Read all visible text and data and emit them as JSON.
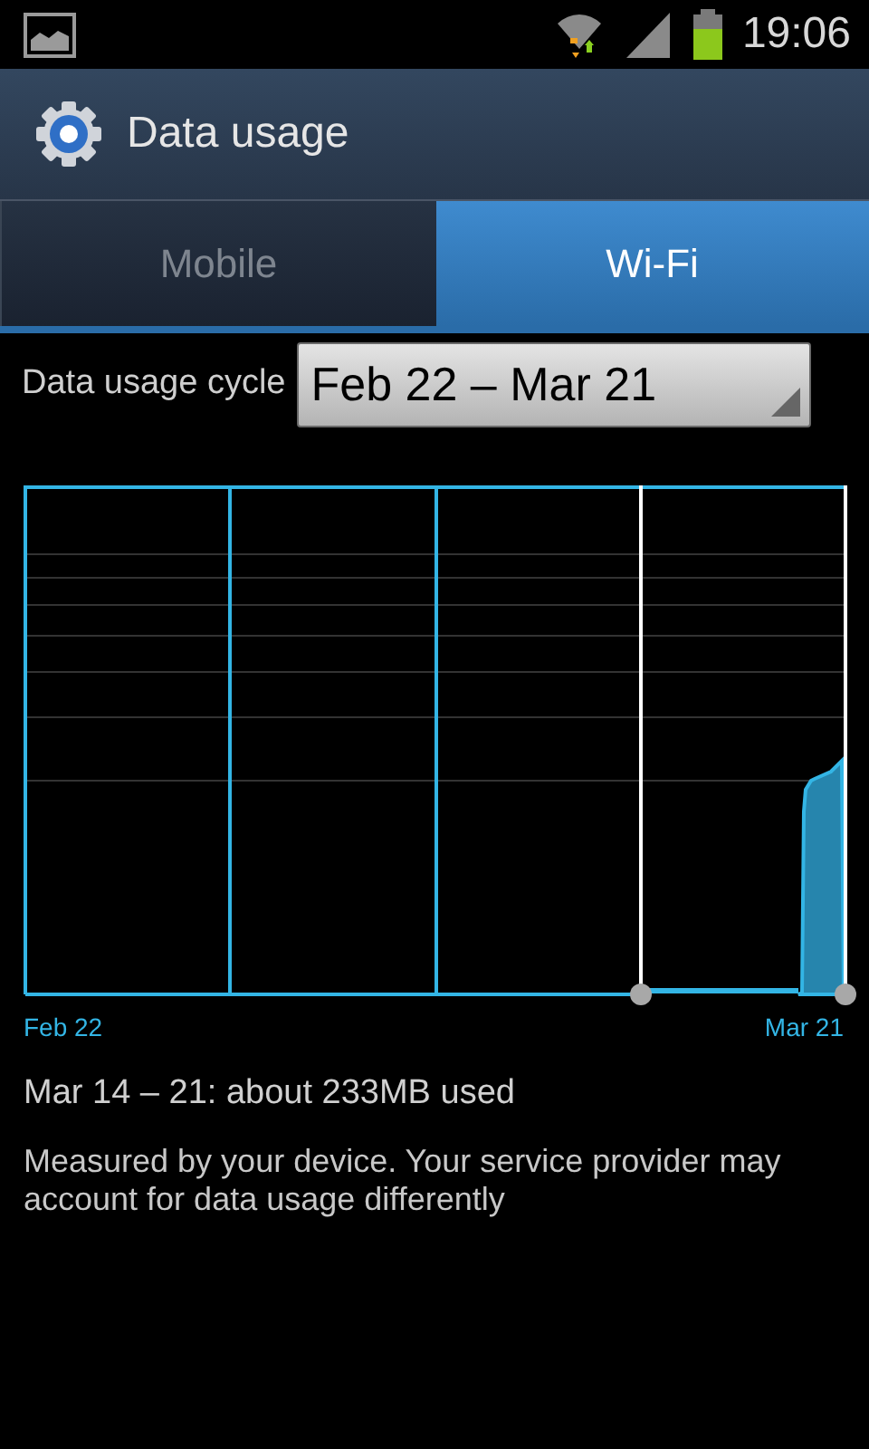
{
  "status_bar": {
    "time": "19:06"
  },
  "action_bar": {
    "title": "Data usage"
  },
  "tabs": [
    {
      "label": "Mobile",
      "selected": false
    },
    {
      "label": "Wi-Fi",
      "selected": true
    }
  ],
  "cycle": {
    "label": "Data usage cycle",
    "value": "Feb 22 – Mar 21"
  },
  "graph": {
    "start_label": "Feb 22",
    "end_label": "Mar 21"
  },
  "summary": "Mar 14 – 21: about 233MB used",
  "note": "Measured by your device. Your service provider may account for data usage differently"
}
